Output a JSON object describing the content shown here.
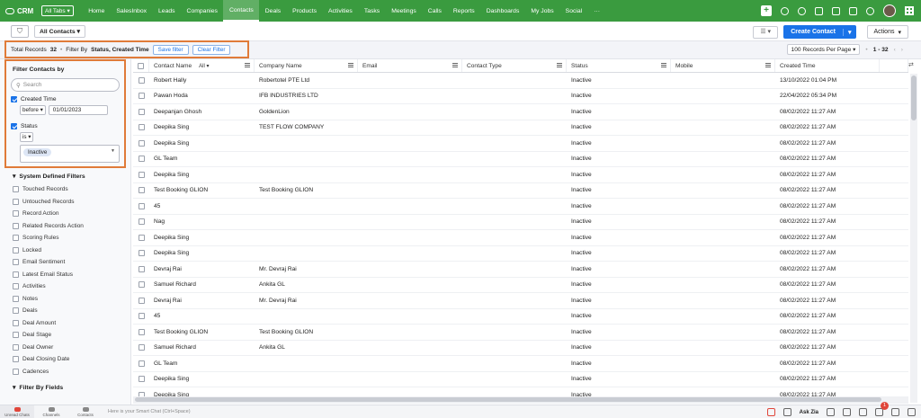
{
  "app": {
    "name": "CRM",
    "all_tabs": "All Tabs"
  },
  "nav": [
    "Home",
    "SalesInbox",
    "Leads",
    "Companies",
    "Contacts",
    "Deals",
    "Products",
    "Activities",
    "Tasks",
    "Meetings",
    "Calls",
    "Reports",
    "Dashboards",
    "My Jobs",
    "Social",
    "···"
  ],
  "nav_active_index": 4,
  "toolbar": {
    "view": "All Contacts",
    "create_label": "Create Contact",
    "actions_label": "Actions"
  },
  "summary": {
    "total_label": "Total Records",
    "total_count": "32",
    "filter_prefix": "Filter By",
    "filter_fields": "Status, Created Time",
    "save_filter": "Save filter",
    "clear_filter": "Clear Filter",
    "per_page": "100 Records Per Page",
    "range": "1 - 32"
  },
  "filters": {
    "title": "Filter Contacts by",
    "search_placeholder": "Search",
    "created_time": {
      "label": "Created Time",
      "operator": "before",
      "value": "01/01/2023"
    },
    "status": {
      "label": "Status",
      "operator": "is",
      "value": "Inactive"
    },
    "system_title": "System Defined Filters",
    "system_items": [
      "Touched Records",
      "Untouched Records",
      "Record Action",
      "Related Records Action",
      "Scoring Rules",
      "Locked",
      "Email Sentiment",
      "Latest Email Status",
      "Activities",
      "Notes",
      "Deals",
      "Deal Amount",
      "Deal Stage",
      "Deal Owner",
      "Deal Closing Date",
      "Cadences"
    ],
    "fields_title": "Filter By Fields"
  },
  "table": {
    "columns": [
      "Contact Name",
      "Company Name",
      "Email",
      "Contact Type",
      "Status",
      "Mobile",
      "Created Time"
    ],
    "name_filter": "All",
    "rows": [
      [
        "Robert Hally",
        "Robertotel PTE Ltd",
        "",
        "",
        "Inactive",
        "",
        "13/10/2022 01:04 PM"
      ],
      [
        "Pawan Hoda",
        "IFB INDUSTRIES LTD",
        "",
        "",
        "Inactive",
        "",
        "22/04/2022 05:34 PM"
      ],
      [
        "Deepanjan Ghosh",
        "GoldenLion",
        "",
        "",
        "Inactive",
        "",
        "08/02/2022 11:27 AM"
      ],
      [
        "Deepika Sing",
        "TEST FLOW COMPANY",
        "",
        "",
        "Inactive",
        "",
        "08/02/2022 11:27 AM"
      ],
      [
        "Deepika Sing",
        "",
        "",
        "",
        "Inactive",
        "",
        "08/02/2022 11:27 AM"
      ],
      [
        "GL Team",
        "",
        "",
        "",
        "Inactive",
        "",
        "08/02/2022 11:27 AM"
      ],
      [
        "Deepika Sing",
        "",
        "",
        "",
        "Inactive",
        "",
        "08/02/2022 11:27 AM"
      ],
      [
        "Test Booking GLION",
        "Test Booking GLION",
        "",
        "",
        "Inactive",
        "",
        "08/02/2022 11:27 AM"
      ],
      [
        "45",
        "",
        "",
        "",
        "Inactive",
        "",
        "08/02/2022 11:27 AM"
      ],
      [
        "Nag",
        "",
        "",
        "",
        "Inactive",
        "",
        "08/02/2022 11:27 AM"
      ],
      [
        "Deepika Sing",
        "",
        "",
        "",
        "Inactive",
        "",
        "08/02/2022 11:27 AM"
      ],
      [
        "Deepika Sing",
        "",
        "",
        "",
        "Inactive",
        "",
        "08/02/2022 11:27 AM"
      ],
      [
        "Devraj Rai",
        "Mr. Devraj Rai",
        "",
        "",
        "Inactive",
        "",
        "08/02/2022 11:27 AM"
      ],
      [
        "Samuel Richard",
        "Ankita GL",
        "",
        "",
        "Inactive",
        "",
        "08/02/2022 11:27 AM"
      ],
      [
        "Devraj Rai",
        "Mr. Devraj Rai",
        "",
        "",
        "Inactive",
        "",
        "08/02/2022 11:27 AM"
      ],
      [
        "45",
        "",
        "",
        "",
        "Inactive",
        "",
        "08/02/2022 11:27 AM"
      ],
      [
        "Test Booking GLION",
        "Test Booking GLION",
        "",
        "",
        "Inactive",
        "",
        "08/02/2022 11:27 AM"
      ],
      [
        "Samuel Richard",
        "Ankita GL",
        "",
        "",
        "Inactive",
        "",
        "08/02/2022 11:27 AM"
      ],
      [
        "GL Team",
        "",
        "",
        "",
        "Inactive",
        "",
        "08/02/2022 11:27 AM"
      ],
      [
        "Deepika Sing",
        "",
        "",
        "",
        "Inactive",
        "",
        "08/02/2022 11:27 AM"
      ],
      [
        "Deepika Sing",
        "",
        "",
        "",
        "Inactive",
        "",
        "08/02/2022 11:27 AM"
      ]
    ]
  },
  "bottom": {
    "items": [
      "Unread Chats",
      "Channels",
      "Contacts"
    ],
    "smartchat": "Here is your Smart Chat (Ctrl+Space)",
    "ask_zia": "Ask Zia",
    "notification_count": "1"
  },
  "colors": {
    "nav": "#3a9b3f",
    "primary": "#1a73e8",
    "highlight": "#e07b39"
  }
}
